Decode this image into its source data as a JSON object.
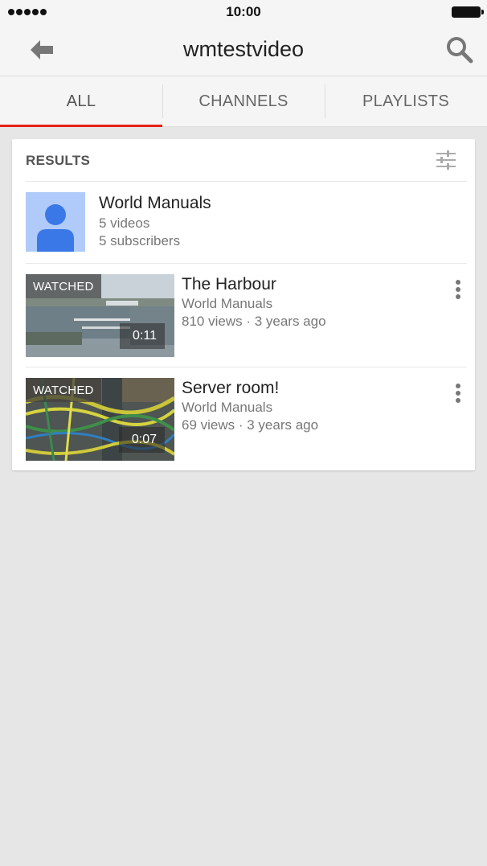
{
  "status_bar": {
    "time": "10:00",
    "signal_icon": "signal-dots-icon",
    "battery_icon": "battery-icon"
  },
  "app_bar": {
    "title": "wmtestvideo",
    "back_icon": "arrow-left-icon",
    "search_icon": "search-icon"
  },
  "tabs": [
    {
      "label": "ALL",
      "active": true
    },
    {
      "label": "CHANNELS",
      "active": false
    },
    {
      "label": "PLAYLISTS",
      "active": false
    }
  ],
  "colors": {
    "accent": "#e62117",
    "background": "#e6e6e6",
    "bar": "#f5f5f5",
    "avatar_bg": "#b0cbf9",
    "avatar_fg": "#3b78e7"
  },
  "results": {
    "header": "RESULTS",
    "filter_icon": "filter-sliders-icon",
    "channel": {
      "name": "World Manuals",
      "videos": "5 videos",
      "subscribers": "5 subscribers"
    },
    "videos": [
      {
        "title": "The Harbour",
        "channel": "World Manuals",
        "stats": "810 views · 3 years ago",
        "badge": "WATCHED",
        "duration": "0:11"
      },
      {
        "title": "Server room!",
        "channel": "World Manuals",
        "stats": "69 views · 3 years ago",
        "badge": "WATCHED",
        "duration": "0:07"
      }
    ]
  }
}
